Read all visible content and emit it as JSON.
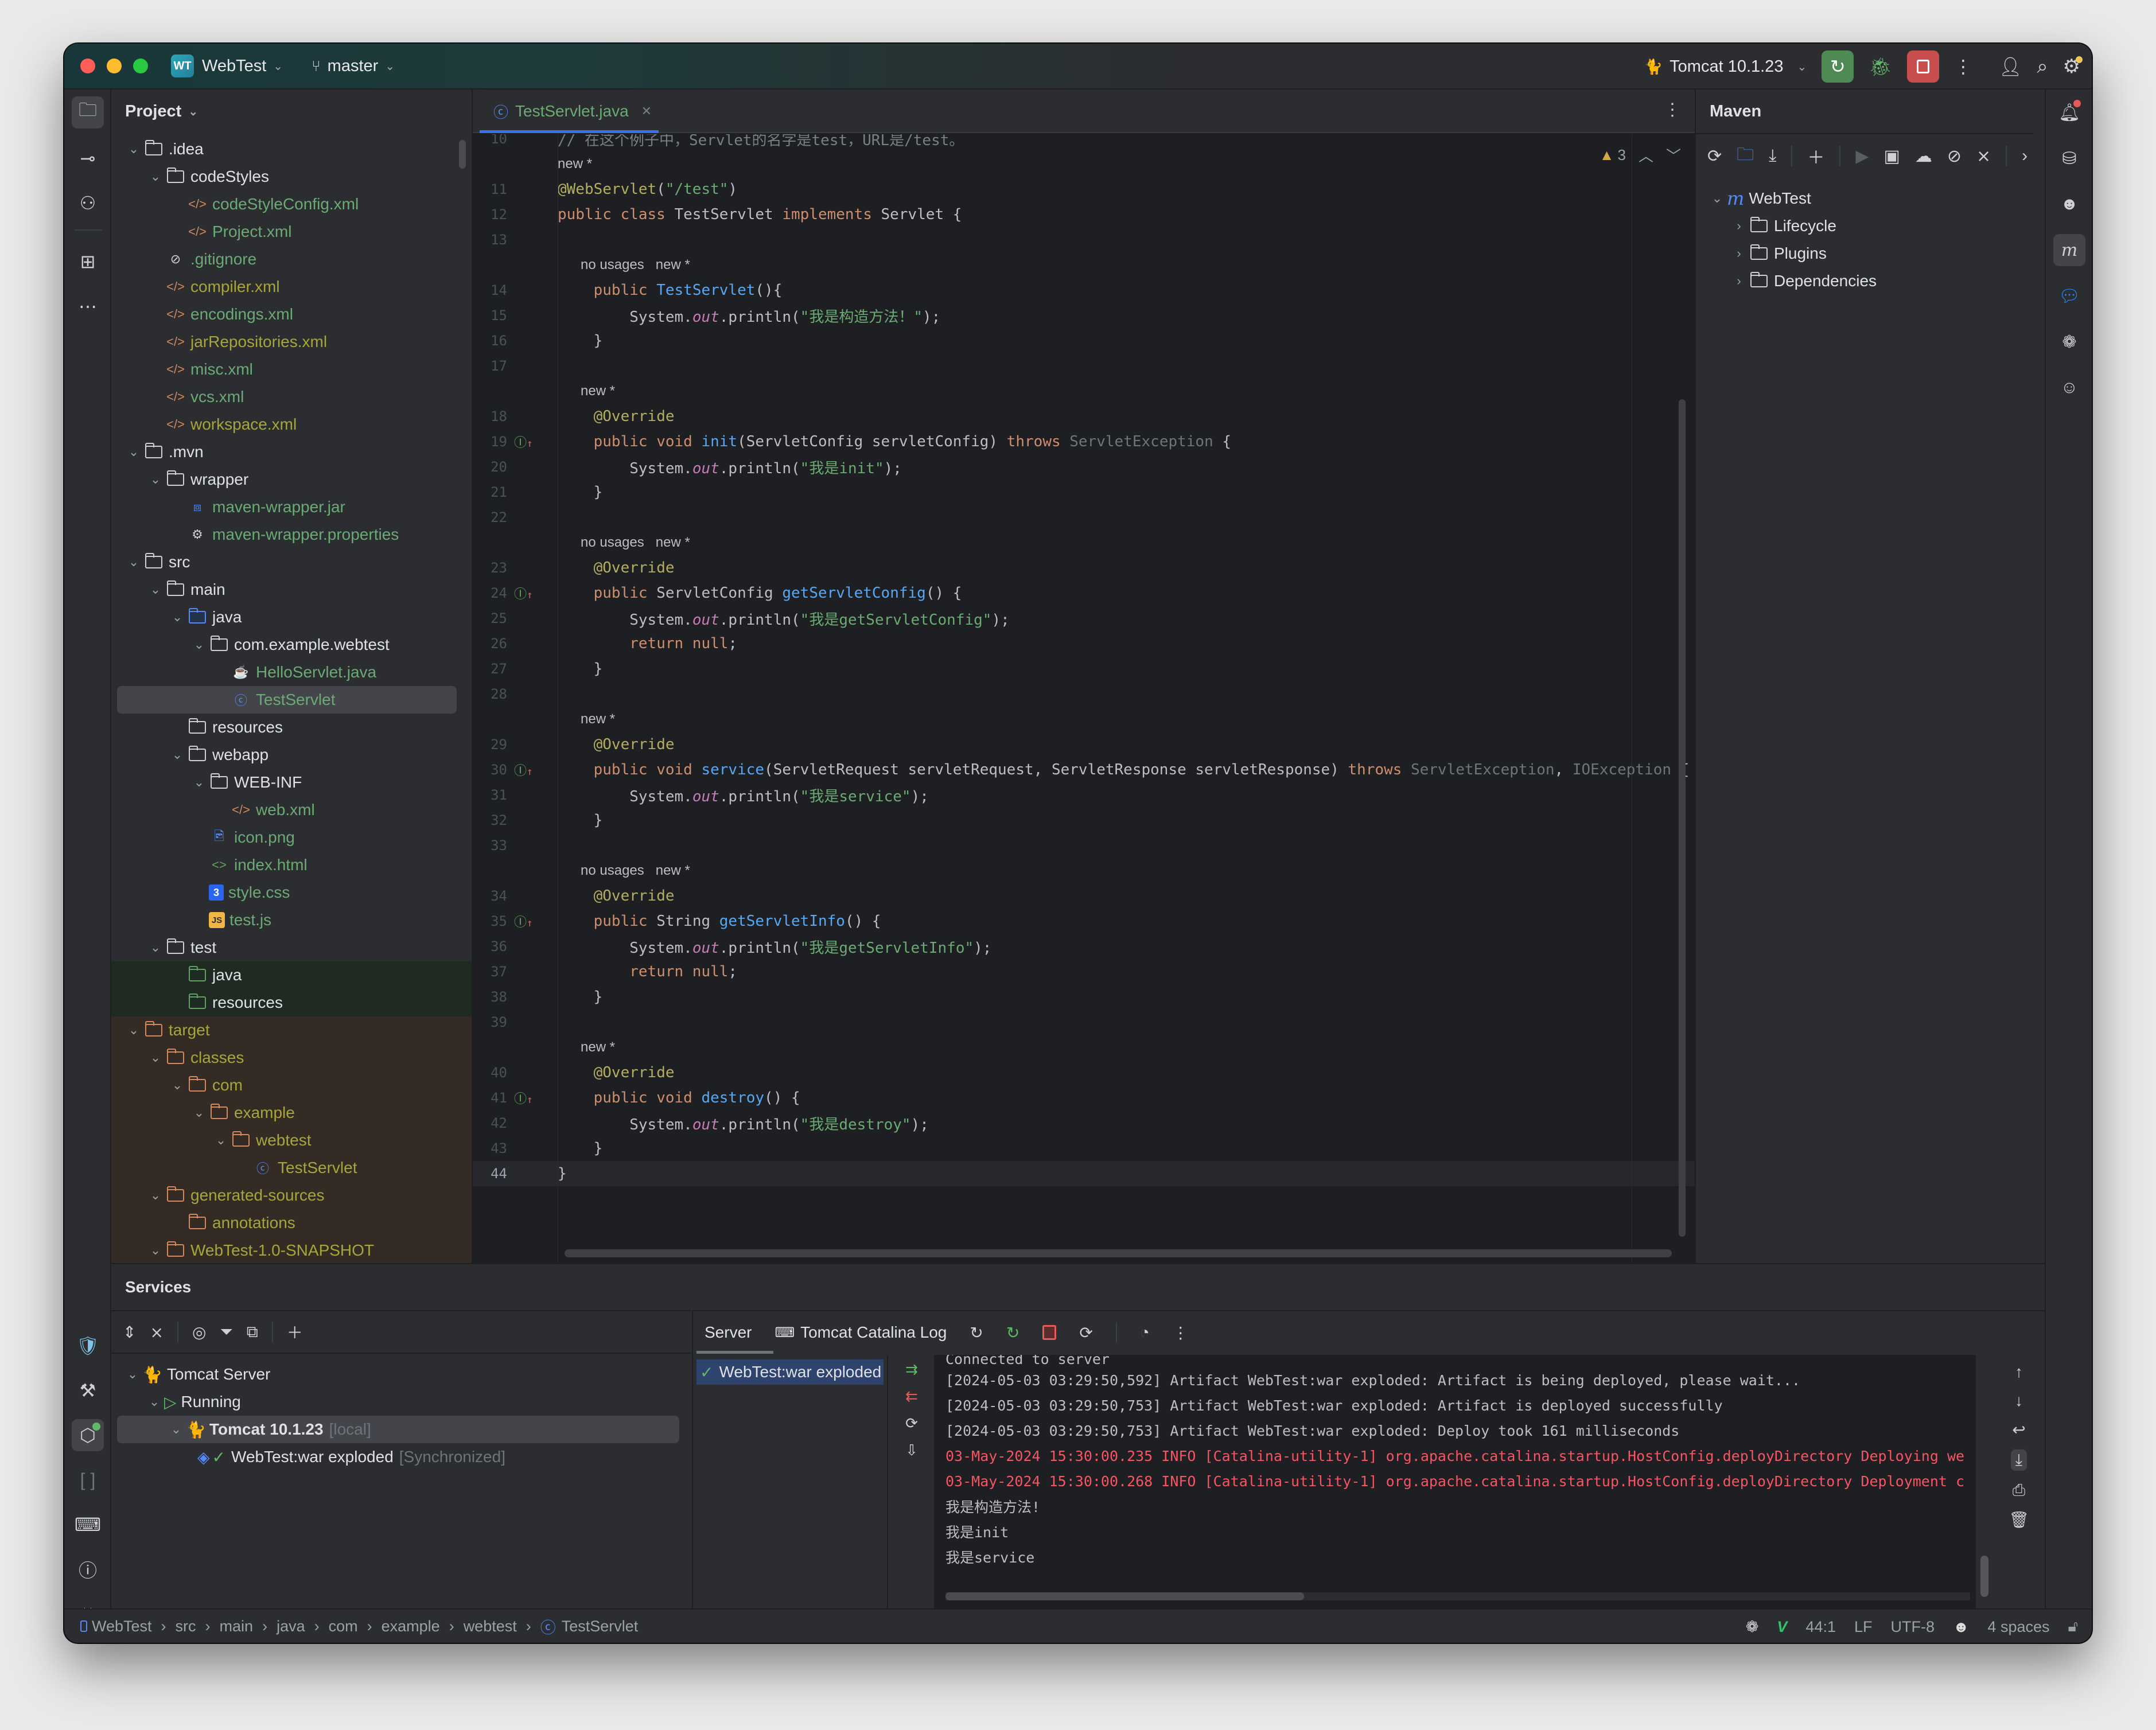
{
  "titlebar": {
    "project_initials": "WT",
    "project_name": "WebTest",
    "branch": "master",
    "run_config": "Tomcat 10.1.23"
  },
  "project_panel": {
    "title": "Project",
    "tree": [
      {
        "depth": 1,
        "expanded": true,
        "icon": "folder",
        "label": ".idea",
        "color": "white"
      },
      {
        "depth": 2,
        "expanded": true,
        "icon": "folder",
        "label": "codeStyles",
        "color": "white"
      },
      {
        "depth": 3,
        "icon": "xml",
        "label": "codeStyleConfig.xml",
        "color": "green"
      },
      {
        "depth": 3,
        "icon": "xml",
        "label": "Project.xml",
        "color": "green"
      },
      {
        "depth": 2,
        "icon": "ignore",
        "label": ".gitignore",
        "color": "green"
      },
      {
        "depth": 2,
        "icon": "xml",
        "label": "compiler.xml",
        "color": "olive"
      },
      {
        "depth": 2,
        "icon": "xml",
        "label": "encodings.xml",
        "color": "green"
      },
      {
        "depth": 2,
        "icon": "xml",
        "label": "jarRepositories.xml",
        "color": "olive"
      },
      {
        "depth": 2,
        "icon": "xml",
        "label": "misc.xml",
        "color": "green"
      },
      {
        "depth": 2,
        "icon": "xml",
        "label": "vcs.xml",
        "color": "green"
      },
      {
        "depth": 2,
        "icon": "xml",
        "label": "workspace.xml",
        "color": "olive"
      },
      {
        "depth": 1,
        "expanded": true,
        "icon": "folder",
        "label": ".mvn",
        "color": "white"
      },
      {
        "depth": 2,
        "expanded": true,
        "icon": "folder",
        "label": "wrapper",
        "color": "white"
      },
      {
        "depth": 3,
        "icon": "jar",
        "label": "maven-wrapper.jar",
        "color": "green"
      },
      {
        "depth": 3,
        "icon": "properties",
        "label": "maven-wrapper.properties",
        "color": "green"
      },
      {
        "depth": 1,
        "expanded": true,
        "icon": "folder",
        "label": "src",
        "color": "white"
      },
      {
        "depth": 2,
        "expanded": true,
        "icon": "folder",
        "label": "main",
        "color": "white"
      },
      {
        "depth": 3,
        "expanded": true,
        "icon": "folder-source",
        "label": "java",
        "color": "white"
      },
      {
        "depth": 4,
        "expanded": true,
        "icon": "package",
        "label": "com.example.webtest",
        "color": "white"
      },
      {
        "depth": 5,
        "icon": "java-file",
        "label": "HelloServlet.java",
        "color": "green"
      },
      {
        "depth": 5,
        "icon": "class",
        "label": "TestServlet",
        "color": "green",
        "selected": true
      },
      {
        "depth": 3,
        "icon": "folder-resources",
        "label": "resources",
        "color": "white"
      },
      {
        "depth": 3,
        "expanded": true,
        "icon": "folder-web",
        "label": "webapp",
        "color": "white"
      },
      {
        "depth": 4,
        "expanded": true,
        "icon": "folder",
        "label": "WEB-INF",
        "color": "white"
      },
      {
        "depth": 5,
        "icon": "web-xml",
        "label": "web.xml",
        "color": "green"
      },
      {
        "depth": 4,
        "icon": "image",
        "label": "icon.png",
        "color": "green"
      },
      {
        "depth": 4,
        "icon": "html",
        "label": "index.html",
        "color": "green"
      },
      {
        "depth": 4,
        "icon": "css",
        "label": "style.css",
        "color": "green"
      },
      {
        "depth": 4,
        "icon": "js",
        "label": "test.js",
        "color": "green"
      },
      {
        "depth": 2,
        "expanded": true,
        "icon": "folder",
        "label": "test",
        "color": "white"
      },
      {
        "depth": 3,
        "icon": "folder-test",
        "label": "java",
        "color": "white",
        "bg": "green"
      },
      {
        "depth": 3,
        "icon": "folder-test-resources",
        "label": "resources",
        "color": "white",
        "bg": "green"
      },
      {
        "depth": 1,
        "expanded": true,
        "icon": "folder-excluded",
        "label": "target",
        "color": "olive",
        "bg": "brown"
      },
      {
        "depth": 2,
        "expanded": true,
        "icon": "folder-excluded",
        "label": "classes",
        "color": "olive",
        "bg": "brown"
      },
      {
        "depth": 3,
        "expanded": true,
        "icon": "folder-excluded",
        "label": "com",
        "color": "olive",
        "bg": "brown"
      },
      {
        "depth": 4,
        "expanded": true,
        "icon": "folder-excluded",
        "label": "example",
        "color": "olive",
        "bg": "brown"
      },
      {
        "depth": 5,
        "expanded": true,
        "icon": "folder-excluded",
        "label": "webtest",
        "color": "olive",
        "bg": "brown"
      },
      {
        "depth": 6,
        "icon": "class",
        "label": "TestServlet",
        "color": "olive",
        "bg": "brown"
      },
      {
        "depth": 2,
        "expanded": true,
        "icon": "folder-excluded",
        "label": "generated-sources",
        "color": "olive",
        "bg": "brown"
      },
      {
        "depth": 3,
        "icon": "folder-excluded",
        "label": "annotations",
        "color": "olive",
        "bg": "brown"
      },
      {
        "depth": 2,
        "expanded": true,
        "icon": "folder-excluded",
        "label": "WebTest-1.0-SNAPSHOT",
        "color": "olive",
        "bg": "brown"
      }
    ]
  },
  "editor": {
    "tab_label": "TestServlet.java",
    "warnings_count": "3",
    "lines": [
      {
        "n": "10",
        "tokens": [
          [
            "cm",
            "// 在这个例子中，Servlet的名字是test，URL是/test。"
          ]
        ]
      },
      {
        "hint": "new *"
      },
      {
        "n": "11",
        "tokens": [
          [
            "an",
            "@WebServlet"
          ],
          [
            "",
            "("
          ],
          [
            "st",
            "\"/test\""
          ],
          [
            "",
            ")"
          ]
        ]
      },
      {
        "n": "12",
        "tokens": [
          [
            "kw",
            "public class "
          ],
          [
            "",
            "TestServlet "
          ],
          [
            "kw",
            "implements "
          ],
          [
            "",
            "Servlet {"
          ]
        ]
      },
      {
        "n": "13",
        "tokens": []
      },
      {
        "hint": "    no usages   new *"
      },
      {
        "n": "14",
        "tokens": [
          [
            "",
            "    "
          ],
          [
            "kw",
            "public "
          ],
          [
            "fn",
            "TestServlet"
          ],
          [
            "",
            "(){"
          ]
        ]
      },
      {
        "n": "15",
        "tokens": [
          [
            "",
            "        System."
          ],
          [
            "fd",
            "out"
          ],
          [
            "",
            ".println("
          ],
          [
            "st",
            "\"我是构造方法！\""
          ],
          [
            "",
            ");"
          ]
        ]
      },
      {
        "n": "16",
        "tokens": [
          [
            "",
            "    }"
          ]
        ]
      },
      {
        "n": "17",
        "tokens": []
      },
      {
        "hint": "    new *"
      },
      {
        "n": "18",
        "tokens": [
          [
            "",
            "    "
          ],
          [
            "an",
            "@Override"
          ]
        ]
      },
      {
        "n": "19",
        "impl": true,
        "tokens": [
          [
            "",
            "    "
          ],
          [
            "kw",
            "public void "
          ],
          [
            "fn",
            "init"
          ],
          [
            "",
            "(ServletConfig servletConfig) "
          ],
          [
            "kw",
            "throws "
          ],
          [
            "ex",
            "ServletException"
          ],
          [
            "",
            " {"
          ]
        ]
      },
      {
        "n": "20",
        "tokens": [
          [
            "",
            "        System."
          ],
          [
            "fd",
            "out"
          ],
          [
            "",
            ".println("
          ],
          [
            "st",
            "\"我是init\""
          ],
          [
            "",
            ");"
          ]
        ]
      },
      {
        "n": "21",
        "tokens": [
          [
            "",
            "    }"
          ]
        ]
      },
      {
        "n": "22",
        "tokens": []
      },
      {
        "hint": "    no usages   new *"
      },
      {
        "n": "23",
        "tokens": [
          [
            "",
            "    "
          ],
          [
            "an",
            "@Override"
          ]
        ]
      },
      {
        "n": "24",
        "impl": true,
        "tokens": [
          [
            "",
            "    "
          ],
          [
            "kw",
            "public "
          ],
          [
            "",
            "ServletConfig "
          ],
          [
            "fn",
            "getServletConfig"
          ],
          [
            "",
            "() {"
          ]
        ]
      },
      {
        "n": "25",
        "tokens": [
          [
            "",
            "        System."
          ],
          [
            "fd",
            "out"
          ],
          [
            "",
            ".println("
          ],
          [
            "st",
            "\"我是getServletConfig\""
          ],
          [
            "",
            ");"
          ]
        ]
      },
      {
        "n": "26",
        "tokens": [
          [
            "",
            "        "
          ],
          [
            "kw",
            "return null"
          ],
          [
            "",
            ";"
          ]
        ]
      },
      {
        "n": "27",
        "tokens": [
          [
            "",
            "    }"
          ]
        ]
      },
      {
        "n": "28",
        "tokens": []
      },
      {
        "hint": "    new *"
      },
      {
        "n": "29",
        "tokens": [
          [
            "",
            "    "
          ],
          [
            "an",
            "@Override"
          ]
        ]
      },
      {
        "n": "30",
        "impl": true,
        "tokens": [
          [
            "",
            "    "
          ],
          [
            "kw",
            "public void "
          ],
          [
            "fn",
            "service"
          ],
          [
            "",
            "(ServletRequest servletRequest, ServletResponse servletResponse) "
          ],
          [
            "kw",
            "throws "
          ],
          [
            "ex",
            "ServletException"
          ],
          [
            "",
            ", "
          ],
          [
            "ex",
            "IOException"
          ],
          [
            "",
            " {"
          ]
        ]
      },
      {
        "n": "31",
        "tokens": [
          [
            "",
            "        System."
          ],
          [
            "fd",
            "out"
          ],
          [
            "",
            ".println("
          ],
          [
            "st",
            "\"我是service\""
          ],
          [
            "",
            ");"
          ]
        ]
      },
      {
        "n": "32",
        "tokens": [
          [
            "",
            "    }"
          ]
        ]
      },
      {
        "n": "33",
        "tokens": []
      },
      {
        "hint": "    no usages   new *"
      },
      {
        "n": "34",
        "tokens": [
          [
            "",
            "    "
          ],
          [
            "an",
            "@Override"
          ]
        ]
      },
      {
        "n": "35",
        "impl": true,
        "tokens": [
          [
            "",
            "    "
          ],
          [
            "kw",
            "public "
          ],
          [
            "",
            "String "
          ],
          [
            "fn",
            "getServletInfo"
          ],
          [
            "",
            "() {"
          ]
        ]
      },
      {
        "n": "36",
        "tokens": [
          [
            "",
            "        System."
          ],
          [
            "fd",
            "out"
          ],
          [
            "",
            ".println("
          ],
          [
            "st",
            "\"我是getServletInfo\""
          ],
          [
            "",
            ");"
          ]
        ]
      },
      {
        "n": "37",
        "tokens": [
          [
            "",
            "        "
          ],
          [
            "kw",
            "return null"
          ],
          [
            "",
            ";"
          ]
        ]
      },
      {
        "n": "38",
        "tokens": [
          [
            "",
            "    }"
          ]
        ]
      },
      {
        "n": "39",
        "tokens": []
      },
      {
        "hint": "    new *"
      },
      {
        "n": "40",
        "tokens": [
          [
            "",
            "    "
          ],
          [
            "an",
            "@Override"
          ]
        ]
      },
      {
        "n": "41",
        "impl": true,
        "tokens": [
          [
            "",
            "    "
          ],
          [
            "kw",
            "public void "
          ],
          [
            "fn",
            "destroy"
          ],
          [
            "",
            "() {"
          ]
        ]
      },
      {
        "n": "42",
        "tokens": [
          [
            "",
            "        System."
          ],
          [
            "fd",
            "out"
          ],
          [
            "",
            ".println("
          ],
          [
            "st",
            "\"我是destroy\""
          ],
          [
            "",
            ");"
          ]
        ]
      },
      {
        "n": "43",
        "tokens": [
          [
            "",
            "    }"
          ]
        ]
      },
      {
        "n": "44",
        "current": true,
        "tokens": [
          [
            "",
            "}"
          ]
        ]
      }
    ]
  },
  "maven": {
    "title": "Maven",
    "root": "WebTest",
    "children": [
      "Lifecycle",
      "Plugins",
      "Dependencies"
    ]
  },
  "services": {
    "title": "Services",
    "tree": [
      {
        "label": "Tomcat Server",
        "suffix": ""
      },
      {
        "label": "Running",
        "suffix": ""
      },
      {
        "label": "Tomcat 10.1.23",
        "suffix": "[local]"
      },
      {
        "label": "WebTest:war exploded",
        "suffix": "[Synchronized]"
      }
    ],
    "tabs": [
      "Server",
      "Tomcat Catalina Log"
    ],
    "deployment": "WebTest:war exploded",
    "console": [
      {
        "type": "normal",
        "text": "Connected to server"
      },
      {
        "type": "normal",
        "text": "[2024-05-03 03:29:50,592] Artifact WebTest:war exploded: Artifact is being deployed, please wait..."
      },
      {
        "type": "normal",
        "text": "[2024-05-03 03:29:50,753] Artifact WebTest:war exploded: Artifact is deployed successfully"
      },
      {
        "type": "normal",
        "text": "[2024-05-03 03:29:50,753] Artifact WebTest:war exploded: Deploy took 161 milliseconds"
      },
      {
        "type": "error",
        "text": "03-May-2024 15:30:00.235 INFO [Catalina-utility-1] org.apache.catalina.startup.HostConfig.deployDirectory Deploying we"
      },
      {
        "type": "error",
        "text": "03-May-2024 15:30:00.268 INFO [Catalina-utility-1] org.apache.catalina.startup.HostConfig.deployDirectory Deployment c"
      },
      {
        "type": "normal",
        "text": "我是构造方法!"
      },
      {
        "type": "normal",
        "text": "我是init"
      },
      {
        "type": "normal",
        "text": "我是service"
      }
    ]
  },
  "statusbar": {
    "breadcrumb": [
      "WebTest",
      "src",
      "main",
      "java",
      "com",
      "example",
      "webtest",
      "TestServlet"
    ],
    "position": "44:1",
    "line_ending": "LF",
    "encoding": "UTF-8",
    "indent": "4 spaces"
  },
  "colors": {
    "accent": "#3574f0",
    "run_green": "#4e8a53",
    "stop_red": "#c94f4f",
    "string": "#6aab73",
    "keyword": "#cf8e6d",
    "error_log": "#f75464"
  }
}
